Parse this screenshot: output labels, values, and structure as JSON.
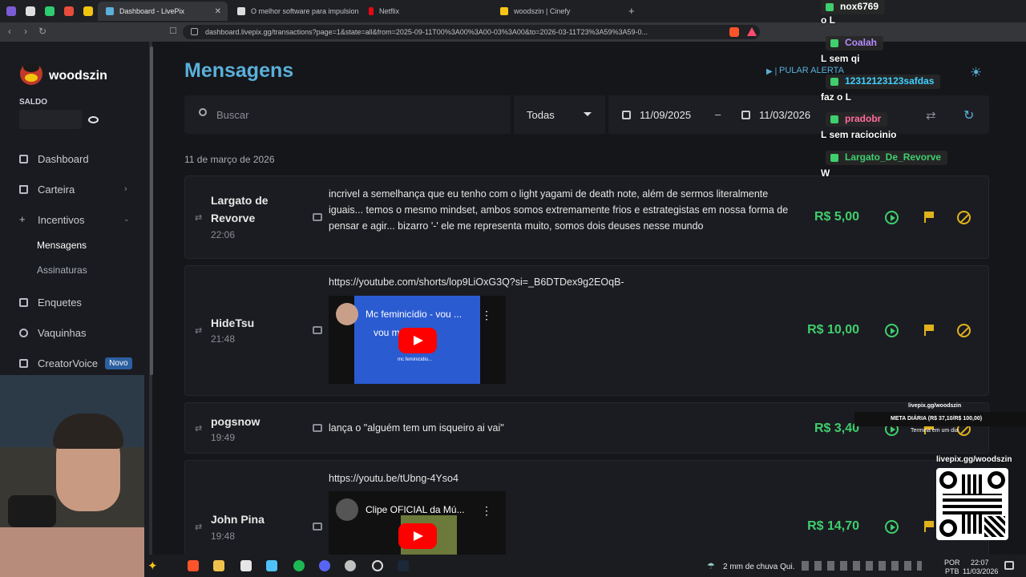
{
  "browser": {
    "tabs": [
      {
        "label": "Dashboard - LivePix",
        "active": true
      },
      {
        "label": "O melhor software para impulsionar"
      },
      {
        "label": "Netflix"
      },
      {
        "label": "woodszin | Cinefy"
      }
    ],
    "url": "dashboard.livepix.gg/transactions?page=1&state=all&from=2025-09-11T00%3A00%3A00-03%3A00&to=2026-03-11T23%3A59%3A59-0..."
  },
  "sidebar": {
    "username": "woodszin",
    "balance_label": "SALDO",
    "items": [
      {
        "label": "Dashboard"
      },
      {
        "label": "Carteira"
      },
      {
        "label": "Incentivos"
      },
      {
        "label": "Enquetes"
      },
      {
        "label": "Vaquinhas"
      },
      {
        "label": "CreatorVoice",
        "badge": "Novo"
      }
    ],
    "subitems": [
      {
        "label": "Mensagens",
        "active": true
      },
      {
        "label": "Assinaturas"
      }
    ]
  },
  "page": {
    "title": "Mensagens",
    "skip_alert": "PULAR ALERTA",
    "search_placeholder": "Buscar",
    "filter_select": "Todas",
    "date_from": "11/09/2025",
    "date_sep": "–",
    "date_to": "11/03/2026",
    "date_group": "11 de março de 2026"
  },
  "messages": [
    {
      "name": "Largato de Revorve",
      "time": "22:06",
      "text": "incrivel a semelhança que eu tenho com o light yagami de death note, além de sermos literalmente iguais... temos o mesmo mindset, ambos somos extremamente frios e estrategistas em nossa forma de pensar e agir... bizarro '-' ele me representa muito, somos dois deuses nesse mundo",
      "amount": "R$ 5,00"
    },
    {
      "name": "HideTsu",
      "time": "21:48",
      "text": "https://youtube.com/shorts/lop9LiOxG3Q?si=_B6DTDex9g2EOqB-",
      "video_title": "Mc feminicídio - vou ...",
      "video_overlay": "vou m     uinha",
      "video_sub": "mc feminicidio...",
      "amount": "R$ 10,00"
    },
    {
      "name": "pogsnow",
      "time": "19:49",
      "text": "lança o \"alguém tem um isqueiro ai vai\"",
      "amount": "R$ 3,40"
    },
    {
      "name": "John Pina",
      "time": "19:48",
      "text": "https://youtu.be/tUbng-4Yso4",
      "video_title": "Clipe OFICIAL da Mú...",
      "amount": "R$ 14,70"
    }
  ],
  "chat": [
    {
      "user": "nox6769",
      "color": "#ffffff",
      "text": "o L"
    },
    {
      "user": "Coalah",
      "color": "#b48cff",
      "text": "L sem qi"
    },
    {
      "user": "12312123123safdas",
      "color": "#3fd0ff",
      "text": "faz o L"
    },
    {
      "user": "pradobr",
      "color": "#ff6b9a",
      "text": "L sem raciocinio"
    },
    {
      "user": "Largato_De_Revorve",
      "color": "#3fcf6d",
      "text": "W"
    }
  ],
  "overlay": {
    "goal_site": "livepix.gg/woodszin",
    "goal_text": "META DIÁRIA (R$ 37,10/R$ 100,00)",
    "goal_ends": "Termina em um dia",
    "qr_label": "livepix.gg/woodszin"
  },
  "taskbar": {
    "weather": "2 mm de chuva Qui.",
    "lang1": "POR",
    "lang2": "PTB",
    "time": "22:07",
    "date": "11/03/2026"
  }
}
